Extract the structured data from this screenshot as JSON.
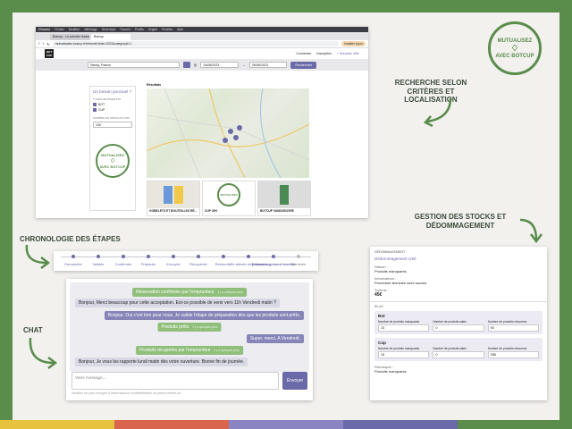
{
  "colors": {
    "green": "#5a8c4c",
    "purple": "#6b6aa8",
    "bottom": [
      "#e7c23e",
      "#d9654d",
      "#8a85c2",
      "#6b6aa8",
      "#5a8c4c"
    ]
  },
  "stamp": {
    "line1": "MUTUALISEZ",
    "line2": "AVEC BOTCUP"
  },
  "annotations": {
    "search": "RECHERCHE SELON CRITÈRES ET LOCALISATION",
    "stock": "GESTION DES STOCKS ET DÉDOMMAGEMENT",
    "timeline": "CHRONOLOGIE DES ÉTAPES",
    "chat": "CHAT"
  },
  "browser": {
    "menu": [
      "Chrome",
      "Fichier",
      "Modifier",
      "Affichage",
      "Historique",
      "Favoris",
      "Profils",
      "Onglet",
      "Fenêtre",
      "Aide"
    ],
    "tabs": [
      "Botcup - Le premier réseau",
      "Botcup"
    ],
    "url": "mutualisation.botcup.fr/fr/events?date=2023&categoryid=1",
    "install": "Installer à jour",
    "nav": [
      "Connexion",
      "Inscription"
    ],
    "new_offer": "+ Nouvelle offre",
    "search": {
      "city": "Nancy, France",
      "date_from": "24/06/2023",
      "date_to": "26/06/2023",
      "button": "Rechercher"
    },
    "sidebar": {
      "title": "Un besoin ponctuel ?",
      "types_label": "TYPES DE PRODUITS",
      "types": [
        "BOT",
        "CUP"
      ],
      "qty_label": "NOMBRE DE PRODUITS MIN",
      "qty_value": "100"
    },
    "results_label": "Résultats",
    "products": [
      "GOBELETS ET BOUTEILLES RÉ...",
      "CUP 20H",
      "BOTCUP VANDOEUVRE"
    ]
  },
  "timeline": [
    "Demandée",
    "Validée",
    "Confirmée",
    "Préparée",
    "Envoyée",
    "Récupérée",
    "Retournée",
    "En attente de paiement",
    "Dédommagement terminé",
    "Terminée"
  ],
  "chat": {
    "messages": [
      {
        "kind": "g",
        "text": "Réservation confirmée par l'emprunteur",
        "time": "il y a quelques jours"
      },
      {
        "kind": "l",
        "text": "Bonjour, Merci beaucoup pour cette acceptation. Est-ce possible de venir vers 11h Vendredi matin ?"
      },
      {
        "kind": "p",
        "text": "Bonjour. Oui c'est bon pour nous. Je valide l'étape de préparation dès que les produits sont prêts."
      },
      {
        "kind": "g",
        "text": "Produits prêts",
        "time": "il y a quelques jours"
      },
      {
        "kind": "p",
        "text": "Super, merci. A Vendredi."
      },
      {
        "kind": "g",
        "text": "Produits récupérés par l'emprunteur",
        "time": "il y a quelques jours"
      },
      {
        "kind": "l",
        "text": "Bonjour, Je vous les rapporte lundi matin dès votre ouverture. Bonne fin de journée."
      }
    ],
    "placeholder": "Votre message...",
    "send": "Envoyer",
    "hint": "Veuillez ne pas envoyer d'informations confidentielles ou personnelles ici"
  },
  "stock": {
    "header": "DÉDOMMAGEMENT",
    "title": "Dédommagement créé",
    "reason_label": "Raison :",
    "reason": "Produits manquants",
    "info_label": "Informations :",
    "info": "Procédure terminée avec succès",
    "amount_label": "Somme :",
    "amount": "45€",
    "section": "BILAN",
    "groups": [
      {
        "name": "Bot",
        "fields": [
          {
            "label": "Nombre de produits manquants",
            "value": "10"
          },
          {
            "label": "Nombre de produits sales",
            "value": "0"
          },
          {
            "label": "Nombre de produits retournés",
            "value": "90"
          }
        ]
      },
      {
        "name": "Cup",
        "fields": [
          {
            "label": "Nombre de produits manquants",
            "value": "15"
          },
          {
            "label": "Nombre de produits sales",
            "value": "0"
          },
          {
            "label": "Nombre de produits retournés",
            "value": "285"
          }
        ]
      }
    ],
    "remark_label": "Remarque :",
    "remark": "Produits manquants"
  }
}
